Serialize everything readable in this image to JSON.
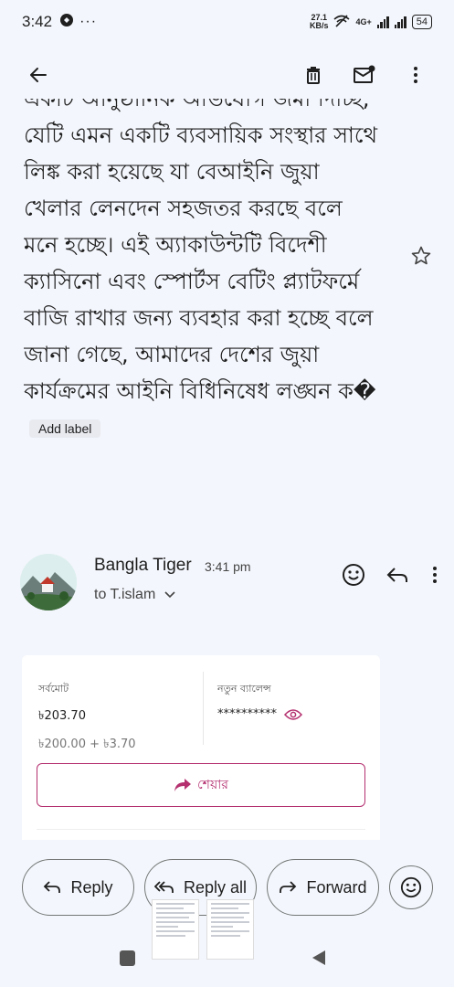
{
  "status_bar": {
    "time": "3:42",
    "notif_dots": "···",
    "net_speed_value": "27.1",
    "net_speed_unit": "KB/s",
    "network_type": "4G+",
    "battery": "54"
  },
  "app_bar": {
    "back_icon": "arrow-left-icon",
    "delete_icon": "trash-icon",
    "mark_unread_icon": "mail-unread-icon",
    "more_icon": "more-vert-icon"
  },
  "email": {
    "body_text": "একটি আনুষ্ঠানিক অভিযোগ জমা দিচ্ছি, যেটি এমন একটি ব্যবসায়িক সংস্থার সাথে লিঙ্ক করা হয়েছে যা বেআইনি জুয়া খেলার লেনদেন সহজতর করছে বলে মনে হচ্ছে। এই অ্যাকাউন্টটি বিদেশী ক্যাসিনো এবং স্পোর্টস বেটিং প্ল্যাটফর্মে বাজি রাখার জন্য ব্যবহার করা হচ্ছে বলে জানা গেছে, আমাদের দেশের জুয়া কার্যক্রমের আইনি বিধিনিষেধ লঙ্ঘন ক�",
    "add_label": "Add label"
  },
  "sender": {
    "name": "Bangla Tiger",
    "time": "3:41 pm",
    "to": "to T.islam"
  },
  "receipt": {
    "total_label": "সর্বমোট",
    "total_value": "৳203.70",
    "total_breakdown": "৳200.00 + ৳3.70",
    "balance_label": "নতুন ব্যালেন্স",
    "balance_value": "**********",
    "share_label": "শেয়ার",
    "accent_color": "#b4306f"
  },
  "reply_bar": {
    "reply": "Reply",
    "reply_all": "Reply all",
    "forward": "Forward"
  }
}
